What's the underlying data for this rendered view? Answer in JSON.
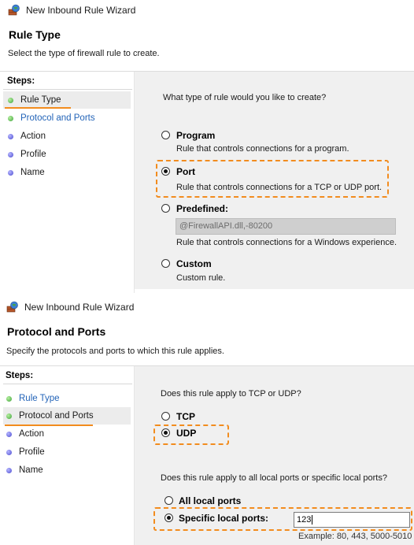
{
  "panel1": {
    "title": "New Inbound Rule Wizard",
    "heading": "Rule Type",
    "subtitle": "Select the type of firewall rule to create.",
    "steps_title": "Steps:",
    "steps": [
      {
        "label": "Rule Type",
        "state": "current"
      },
      {
        "label": "Protocol and Ports",
        "state": "pending-link"
      },
      {
        "label": "Action",
        "state": "pending"
      },
      {
        "label": "Profile",
        "state": "pending"
      },
      {
        "label": "Name",
        "state": "pending"
      }
    ],
    "question": "What type of rule would you like to create?",
    "options": [
      {
        "label": "Program",
        "desc": "Rule that controls connections for a program.",
        "checked": false
      },
      {
        "label": "Port",
        "desc": "Rule that controls connections for a TCP or UDP port.",
        "checked": true
      },
      {
        "label": "Predefined:",
        "desc": "Rule that controls connections for a Windows experience.",
        "checked": false,
        "combo": "@FirewallAPI.dll,-80200"
      },
      {
        "label": "Custom",
        "desc": "Custom rule.",
        "checked": false
      }
    ]
  },
  "panel2": {
    "title": "New Inbound Rule Wizard",
    "heading": "Protocol and Ports",
    "subtitle": "Specify the protocols and ports to which this rule applies.",
    "steps_title": "Steps:",
    "steps": [
      {
        "label": "Rule Type",
        "state": "done-link"
      },
      {
        "label": "Protocol and Ports",
        "state": "current"
      },
      {
        "label": "Action",
        "state": "pending"
      },
      {
        "label": "Profile",
        "state": "pending"
      },
      {
        "label": "Name",
        "state": "pending"
      }
    ],
    "question1": "Does this rule apply to TCP or UDP?",
    "protocols": [
      {
        "label": "TCP",
        "checked": false
      },
      {
        "label": "UDP",
        "checked": true
      }
    ],
    "question2": "Does this rule apply to all local ports or specific local ports?",
    "ports": [
      {
        "label": "All local ports",
        "checked": false
      },
      {
        "label": "Specific local ports:",
        "checked": true
      }
    ],
    "ports_value": "123",
    "ports_example": "Example: 80, 443, 5000-5010"
  },
  "colors": {
    "highlight": "#f28c1e",
    "link": "#2364b8",
    "content_bg": "#f0f0f0"
  },
  "icons": {
    "window": "firewall-wizard-icon"
  }
}
